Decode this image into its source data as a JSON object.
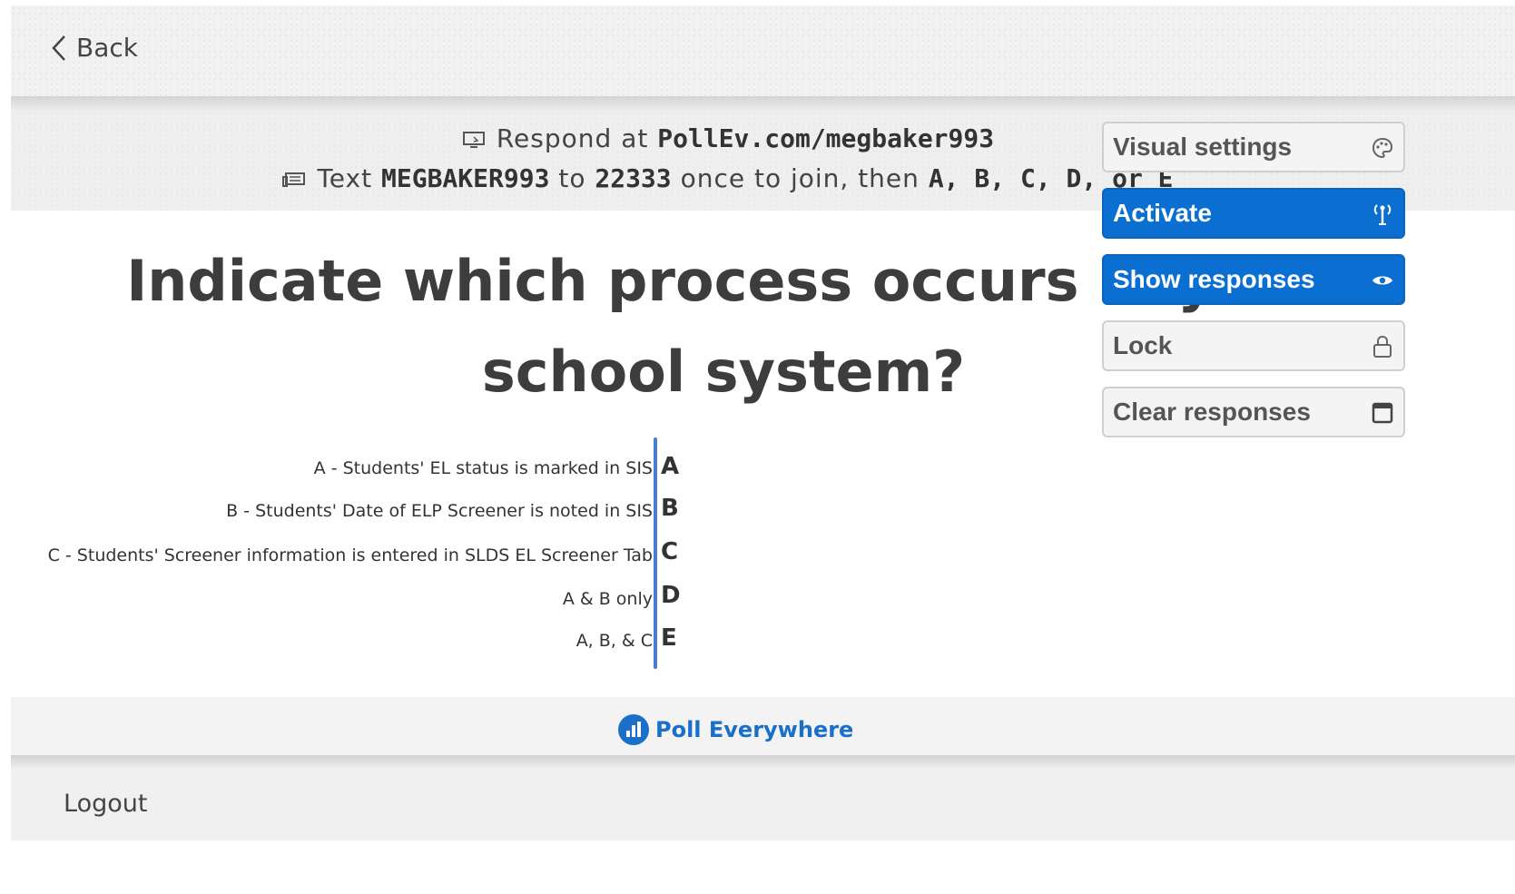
{
  "topbar": {
    "back_label": "Back"
  },
  "instructions": {
    "line1_prefix": "Respond at",
    "line1_url": "PollEv.com/megbaker993",
    "line2_text": "Text",
    "line2_code": "MEGBAKER993",
    "line2_to": "to",
    "line2_number": "22333",
    "line2_mid": "once to join, then",
    "line2_options": "A, B, C, D, or E"
  },
  "question": {
    "title": "Indicate which process occurs in your school system?"
  },
  "options": [
    {
      "label": "A - Students' EL status is marked in SIS",
      "letter": "A"
    },
    {
      "label": "B - Students' Date of ELP Screener is noted in SIS",
      "letter": "B"
    },
    {
      "label": "C - Students' Screener information is entered in SLDS EL Screener Tab",
      "letter": "C"
    },
    {
      "label": "A & B only",
      "letter": "D"
    },
    {
      "label": "A, B, & C",
      "letter": "E"
    }
  ],
  "footer": {
    "brand": "Poll Everywhere",
    "logout_label": "Logout"
  },
  "panel": {
    "visual_settings": "Visual settings",
    "activate": "Activate",
    "show_responses": "Show responses",
    "lock": "Lock",
    "clear_responses": "Clear responses"
  },
  "colors": {
    "accent_blue": "#0a6fd1",
    "axis_blue": "#4a7ccf"
  },
  "icons": [
    "chevron-left-icon",
    "monitor-icon",
    "sms-icon",
    "palette-icon",
    "antenna-icon",
    "eye-icon",
    "lock-icon",
    "trash-icon",
    "poll-everywhere-logo"
  ]
}
